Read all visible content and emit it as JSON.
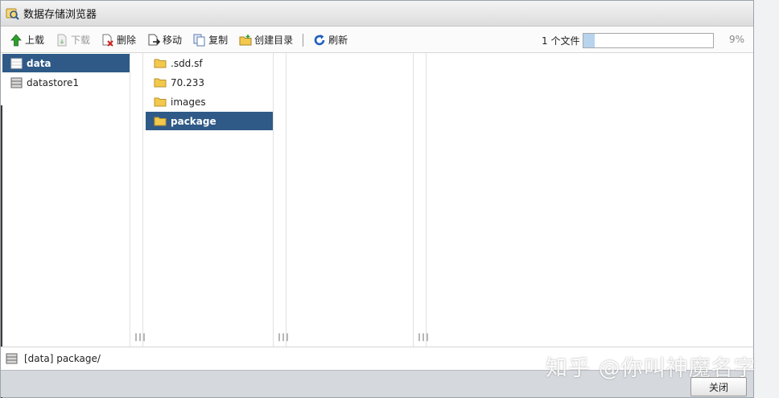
{
  "window": {
    "title": "数据存储浏览器"
  },
  "toolbar": {
    "upload": "上载",
    "download": "下载",
    "delete": "删除",
    "move": "移动",
    "copy": "复制",
    "create_dir": "创建目录",
    "refresh": "刷新",
    "file_count": "1 个文件",
    "progress_percent": 9,
    "progress_label": "9%"
  },
  "datastores": [
    {
      "label": "data",
      "selected": true
    },
    {
      "label": "datastore1",
      "selected": false
    }
  ],
  "folders": [
    {
      "label": ".sdd.sf",
      "selected": false
    },
    {
      "label": "70.233",
      "selected": false
    },
    {
      "label": "images",
      "selected": false
    },
    {
      "label": "package",
      "selected": true
    }
  ],
  "grip": "|||",
  "status": {
    "path": "[data] package/"
  },
  "footer": {
    "close_label": "关闭"
  },
  "watermark": "知乎 @你叫神魔名字",
  "colors": {
    "selection": "#2f5a87",
    "progress_fill": "#b7d3ee",
    "folder": "#f2c94c",
    "upload_arrow": "#2e9e2e",
    "refresh": "#1f5fbf",
    "delete_x": "#d02020"
  }
}
